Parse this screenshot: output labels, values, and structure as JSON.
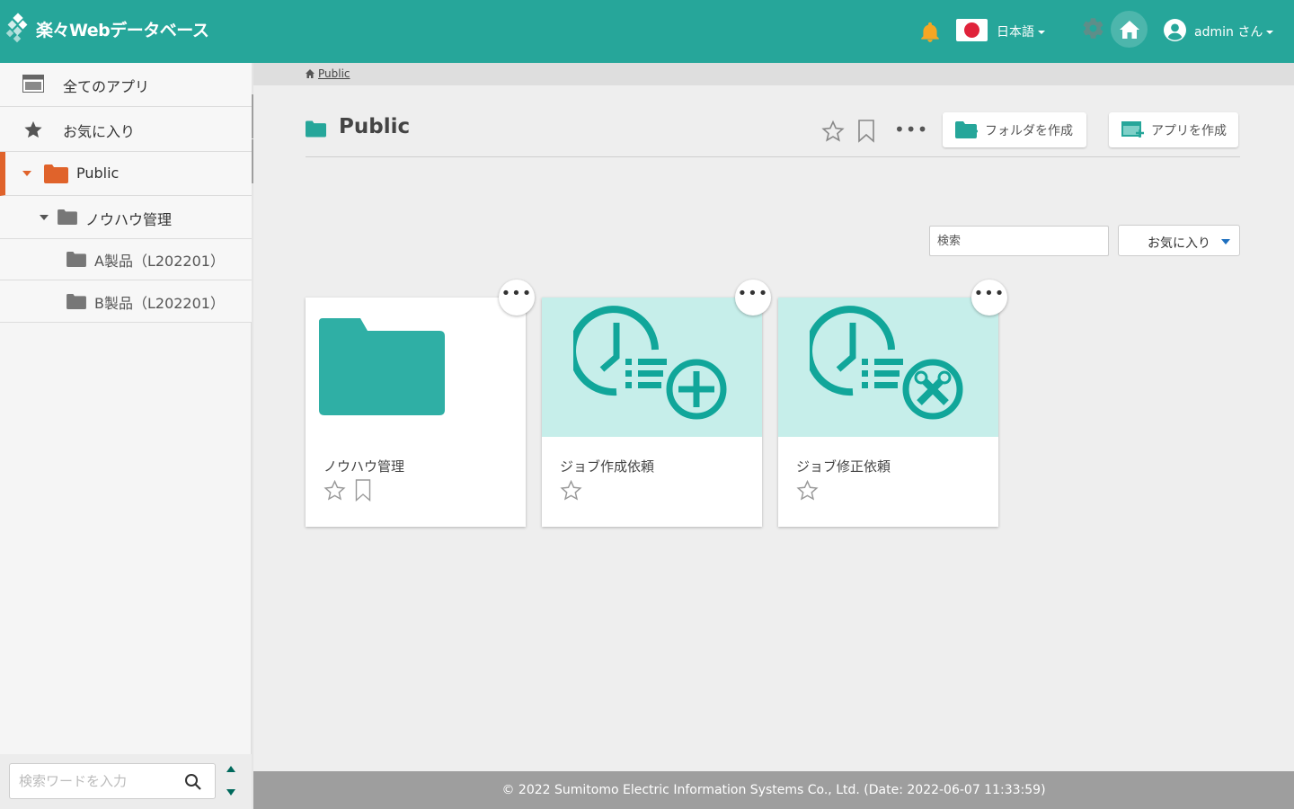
{
  "header": {
    "logo_text": "楽々Webデータベース",
    "language": "日本語",
    "user": "admin さん",
    "colors": {
      "header_bg": "#26a69a",
      "accent_orange": "#e0632b",
      "notification": "#f5a623"
    }
  },
  "sidebar": {
    "items": [
      {
        "label": "全てのアプリ",
        "icon": "window-icon"
      },
      {
        "label": "お気に入り",
        "icon": "star-icon"
      },
      {
        "label": "Public",
        "icon": "folder-icon"
      },
      {
        "label": "ノウハウ管理",
        "icon": "folder-icon"
      },
      {
        "label": "A製品（L202201）",
        "icon": "folder-icon"
      },
      {
        "label": "B製品（L202201）",
        "icon": "folder-icon"
      }
    ],
    "search_placeholder": "検索ワードを入力"
  },
  "breadcrumb": {
    "items": [
      "Public"
    ]
  },
  "main": {
    "title": "Public",
    "buttons": {
      "create_folder": "フォルダを作成",
      "create_app": "アプリを作成"
    },
    "search_placeholder": "検索",
    "filter_value": "お気に入り",
    "cards": [
      {
        "title": "ノウハウ管理",
        "type": "folder",
        "icon": "folder-icon"
      },
      {
        "title": "ジョブ作成依頼",
        "type": "app",
        "icon": "clock-list-plus-icon"
      },
      {
        "title": "ジョブ修正依頼",
        "type": "app",
        "icon": "clock-list-tools-icon"
      }
    ]
  },
  "footer": {
    "text": "© 2022 Sumitomo Electric Information Systems Co., Ltd. (Date: 2022-06-07 11:33:59)"
  }
}
